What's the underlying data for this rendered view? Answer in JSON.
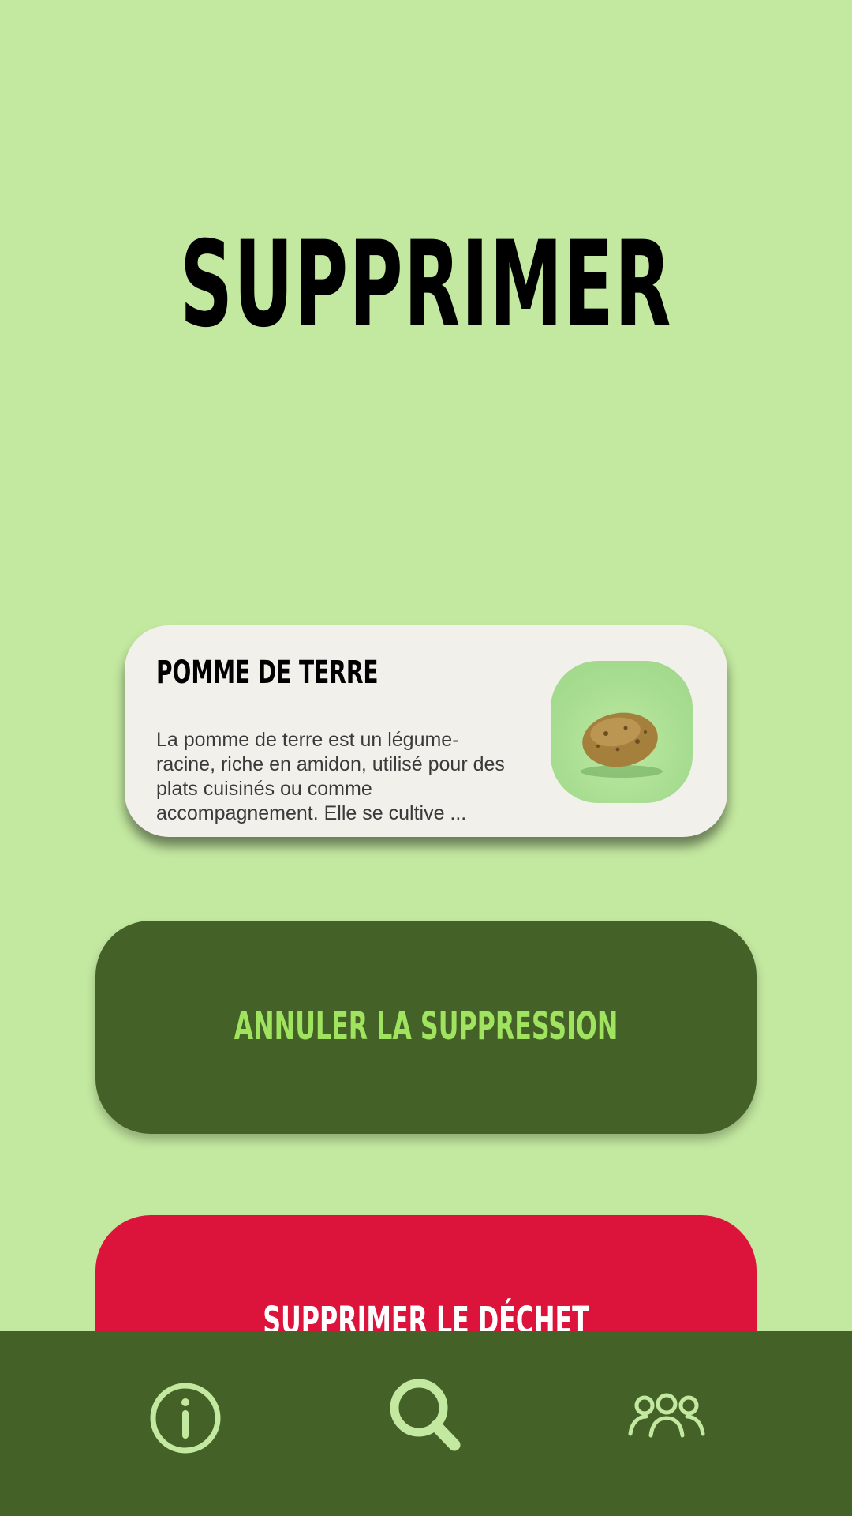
{
  "page": {
    "title": "SUPPRIMER"
  },
  "item_card": {
    "name": "POMME DE TERRE",
    "description": "La pomme de terre est un légume-racine, riche en amidon, utilisé pour des plats cuisinés ou comme accompagnement. Elle se cultive ...",
    "image_icon": "potato-image"
  },
  "actions": {
    "cancel_label": "ANNULER LA SUPPRESSION",
    "delete_label": "SUPPRIMER LE DÉCHET"
  },
  "bottom_nav": {
    "items": [
      {
        "icon": "info-icon"
      },
      {
        "icon": "search-icon"
      },
      {
        "icon": "community-icon"
      }
    ]
  },
  "colors": {
    "background": "#c3e8a0",
    "dark_green": "#446128",
    "light_green_text": "#9fe35f",
    "delete_red": "#dc143c",
    "card_background": "#f1f0eb",
    "nav_icon": "#c3e8a0"
  }
}
